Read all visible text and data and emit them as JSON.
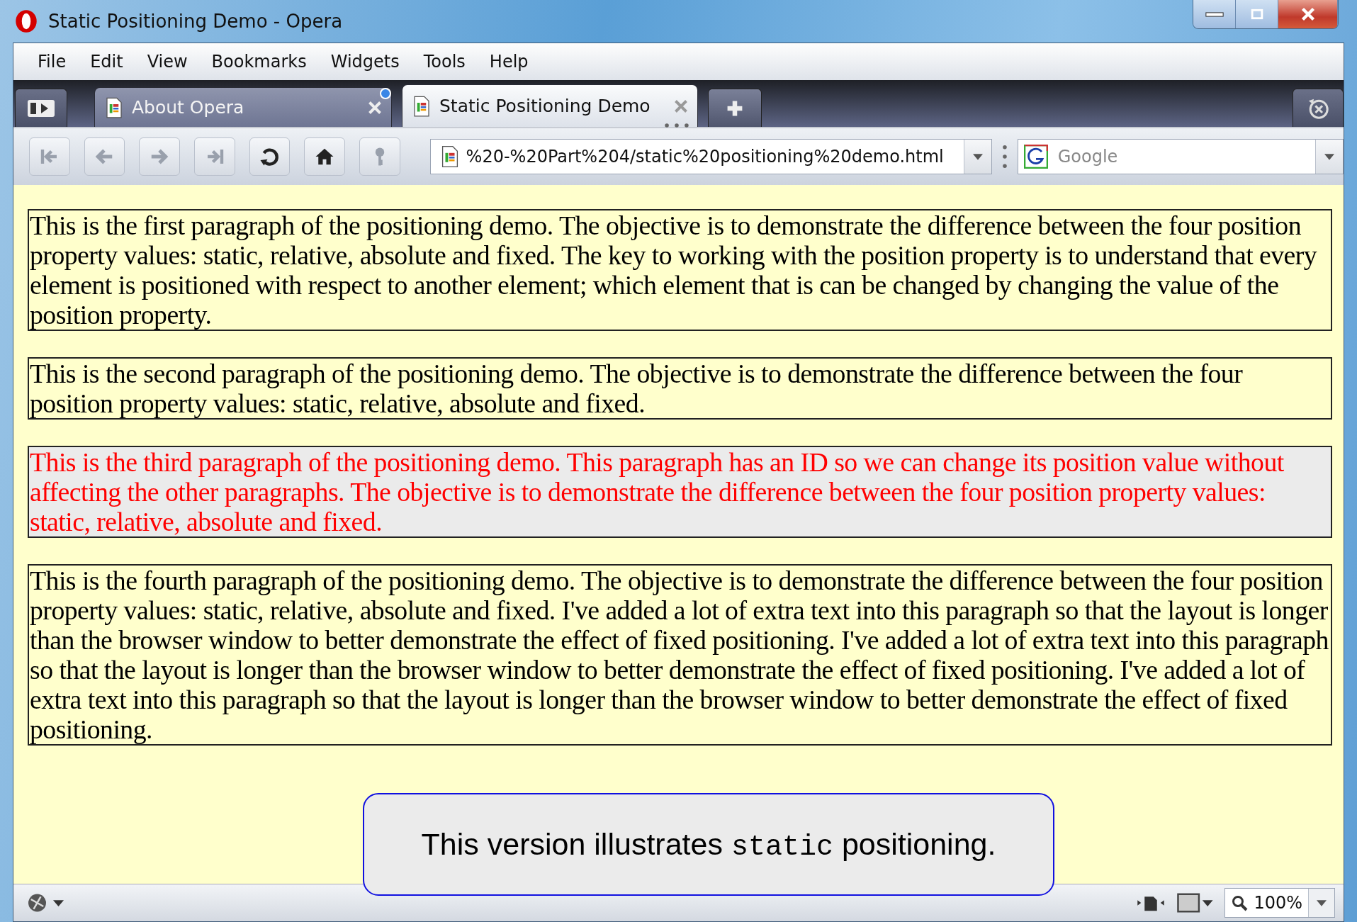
{
  "window": {
    "title": "Static Positioning Demo - Opera"
  },
  "menu": [
    "File",
    "Edit",
    "View",
    "Bookmarks",
    "Widgets",
    "Tools",
    "Help"
  ],
  "tabs": [
    {
      "label": "About Opera",
      "selected": false,
      "unread": true
    },
    {
      "label": "Static Positioning Demo",
      "selected": true,
      "unread": false
    }
  ],
  "toolbar": [
    {
      "kind": "rewind",
      "disabled": true
    },
    {
      "kind": "back",
      "disabled": true
    },
    {
      "kind": "forward",
      "disabled": true
    },
    {
      "kind": "fast-forward",
      "disabled": true
    },
    {
      "kind": "reload",
      "disabled": false
    },
    {
      "kind": "home",
      "disabled": false
    },
    {
      "kind": "key",
      "disabled": true
    }
  ],
  "address": {
    "value": "%20-%20Part%204/static%20positioning%20demo.html"
  },
  "search": {
    "placeholder": "Google"
  },
  "paragraphs": [
    {
      "kind": "normal",
      "text": "This is the first paragraph of the positioning demo. The objective is to demonstrate the difference between the four position property values: static, relative, absolute and fixed. The key to working with the position property is to understand that every element is positioned with respect to another element; which element that is can be changed by changing the value of the position property."
    },
    {
      "kind": "normal",
      "text": "This is the second paragraph of the positioning demo. The objective is to demonstrate the difference between the four position property values: static, relative, absolute and fixed."
    },
    {
      "kind": "highlighted",
      "text": "This is the third paragraph of the positioning demo. This paragraph has an ID so we can change its position value without affecting the other paragraphs. The objective is to demonstrate the difference between the four position property values: static, relative, absolute and fixed."
    },
    {
      "kind": "normal",
      "text": "This is the fourth paragraph of the positioning demo. The objective is to demonstrate the difference between the four position property values: static, relative, absolute and fixed. I've added a lot of extra text into this paragraph so that the layout is longer than the browser window to better demonstrate the effect of fixed positioning. I've added a lot of extra text into this paragraph so that the layout is longer than the browser window to better demonstrate the effect of fixed positioning. I've added a lot of extra text into this paragraph so that the layout is longer than the browser window to better demonstrate the effect of fixed positioning."
    }
  ],
  "note": {
    "text_before": "This version illustrates",
    "code": "static",
    "text_after": "positioning."
  },
  "status_bar": {
    "zoom": "100%"
  }
}
